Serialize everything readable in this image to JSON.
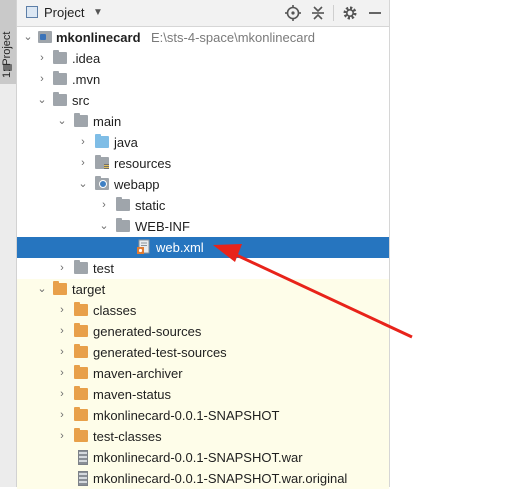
{
  "toolwindow_strip": {
    "tab_label": "1: Project"
  },
  "header": {
    "title": "Project",
    "buttons": [
      "locate-icon",
      "collapse-all-icon",
      "settings-icon",
      "hide-icon"
    ]
  },
  "tree": {
    "rows": [
      {
        "label": "mkonlinecard",
        "path": "E:\\sts-4-space\\mkonlinecard"
      },
      {
        "label": ".idea"
      },
      {
        "label": ".mvn"
      },
      {
        "label": "src"
      },
      {
        "label": "main"
      },
      {
        "label": "java"
      },
      {
        "label": "resources"
      },
      {
        "label": "webapp"
      },
      {
        "label": "static"
      },
      {
        "label": "WEB-INF"
      },
      {
        "label": "web.xml"
      },
      {
        "label": "test"
      },
      {
        "label": "target"
      },
      {
        "label": "classes"
      },
      {
        "label": "generated-sources"
      },
      {
        "label": "generated-test-sources"
      },
      {
        "label": "maven-archiver"
      },
      {
        "label": "maven-status"
      },
      {
        "label": "mkonlinecard-0.0.1-SNAPSHOT"
      },
      {
        "label": "test-classes"
      },
      {
        "label": "mkonlinecard-0.0.1-SNAPSHOT.war"
      },
      {
        "label": "mkonlinecard-0.0.1-SNAPSHOT.war.original"
      }
    ],
    "selected": "web.xml"
  },
  "colors": {
    "selection": "#2675bf",
    "target_background": "#fefde9",
    "annotation_arrow": "#e8231a"
  }
}
